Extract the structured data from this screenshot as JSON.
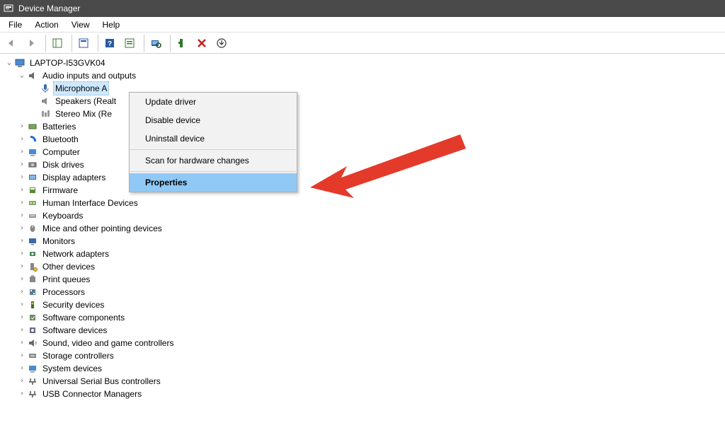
{
  "title": "Device Manager",
  "menubar": [
    "File",
    "Action",
    "View",
    "Help"
  ],
  "root": "LAPTOP-I53GVK04",
  "audio": {
    "label": "Audio inputs and outputs",
    "children": [
      "Microphone A",
      "Speakers (Realt",
      "Stereo Mix (Re"
    ]
  },
  "categories": [
    "Batteries",
    "Bluetooth",
    "Computer",
    "Disk drives",
    "Display adapters",
    "Firmware",
    "Human Interface Devices",
    "Keyboards",
    "Mice and other pointing devices",
    "Monitors",
    "Network adapters",
    "Other devices",
    "Print queues",
    "Processors",
    "Security devices",
    "Software components",
    "Software devices",
    "Sound, video and game controllers",
    "Storage controllers",
    "System devices",
    "Universal Serial Bus controllers",
    "USB Connector Managers"
  ],
  "context": {
    "items": [
      "Update driver",
      "Disable device",
      "Uninstall device",
      "Scan for hardware changes",
      "Properties"
    ],
    "highlighted": "Properties"
  }
}
